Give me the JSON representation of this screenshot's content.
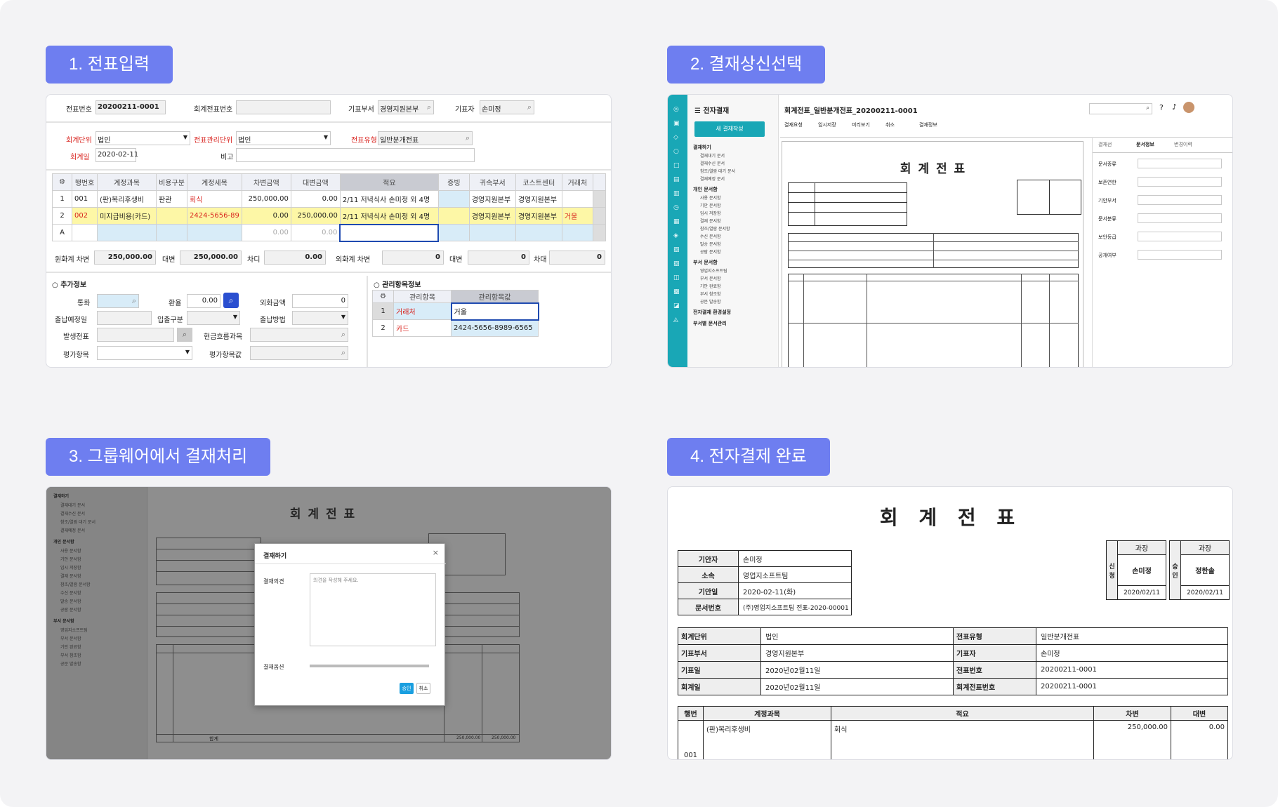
{
  "steps": [
    {
      "label": "1. 전표입력"
    },
    {
      "label": "2. 결재상신선택"
    },
    {
      "label": "3. 그룹웨어에서 결재처리"
    },
    {
      "label": "4. 전자결제 완료"
    }
  ],
  "entry": {
    "voucher_no_label": "전표번호",
    "voucher_no": "20200211-0001",
    "acct_no_label": "회계전표번호",
    "issuer_dept_label": "기표부서",
    "issuer_dept": "경영지원본부",
    "issuer_label": "기표자",
    "issuer": "손미정",
    "acct_unit_label": "회계단위",
    "acct_unit": "법인",
    "mgmt_unit_label": "전표관리단위",
    "mgmt_unit": "법인",
    "voucher_type_label": "전표유형",
    "voucher_type": "일반분개전표",
    "acct_date_label": "회계일",
    "acct_date": "2020-02-11",
    "note_label": "비고",
    "grid_headers": [
      "행번호",
      "계정과목",
      "비용구분",
      "계정세목",
      "차변금액",
      "대변금액",
      "적요",
      "증빙",
      "귀속부서",
      "코스트센터",
      "거래처"
    ],
    "rows": [
      {
        "no": "1",
        "code": "001",
        "account": "(판)복리후생비",
        "cost": "판관",
        "sub": "회식",
        "debit": "250,000.00",
        "credit": "0.00",
        "memo": "2/11 저녁식사 손미정 외 4명",
        "proof": "",
        "dept": "경영지원본부",
        "center": "경영지원본부",
        "partner": ""
      },
      {
        "no": "2",
        "code": "002",
        "account": "미지급비용(카드)",
        "cost": "",
        "sub": "2424-5656-89",
        "debit": "0.00",
        "credit": "250,000.00",
        "memo": "2/11 저녁식사 손미정 외 4명",
        "proof": "",
        "dept": "경영지원본부",
        "center": "경영지원본부",
        "partner": "거울"
      },
      {
        "no": "A",
        "code": "",
        "account": "",
        "cost": "",
        "sub": "",
        "debit": "0.00",
        "credit": "0.00",
        "memo": "",
        "proof": "",
        "dept": "",
        "center": "",
        "partner": ""
      }
    ],
    "totals": {
      "krw_debit_label": "원화계 차변",
      "krw_debit": "250,000.00",
      "krw_credit_label": "대변",
      "krw_credit": "250,000.00",
      "krw_diff_label": "차디",
      "krw_diff": "0.00",
      "fx_debit_label": "외화계 차변",
      "fx_debit": "0",
      "fx_credit_label": "대변",
      "fx_credit": "0",
      "fx_diff_label": "차대",
      "fx_diff": "0"
    },
    "extra_title": "추가정보",
    "extra": {
      "currency": "통화",
      "rate": "환율",
      "rate_value": "0.00",
      "fx_amount": "외화금액",
      "fx_amount_value": "0",
      "pay_date": "출납예정일",
      "io_type": "입출구분",
      "pay_method": "출납방법",
      "origin": "발생전표",
      "cash_flow": "현금흐름과목",
      "eval_item": "평가항목",
      "eval_value": "평가항목값"
    },
    "mgmt_title": "관리항목정보",
    "mgmt_headers": [
      "관리항목",
      "관리항목값"
    ],
    "mgmt_rows": [
      {
        "no": "1",
        "item": "거래처",
        "value": "거울"
      },
      {
        "no": "2",
        "item": "카드",
        "value": "2424-5656-8989-6565"
      }
    ]
  },
  "approval": {
    "app_title": "전자결재",
    "new_button": "새 결재작성",
    "menu_groups": [
      {
        "title": "결재하기",
        "items": [
          "결재대기 문서",
          "결재수신 문서",
          "참조/열람 대기 문서",
          "결재예정 문서"
        ]
      },
      {
        "title": "개인 문서함",
        "items": [
          "사용 문서함",
          "기안 문서함",
          "임시 저장함",
          "결재 문서함",
          "참조/열람 문서함",
          "수신 문서함",
          "발송 문서함",
          "공람 문서함"
        ]
      },
      {
        "title": "부서 문서함",
        "items": [
          "영업지소프트팀",
          "부서 문서함",
          "기안 완료함",
          "부서 참조함",
          "공문 발송함"
        ]
      },
      {
        "title": "전자결재 환경설정",
        "items": []
      },
      {
        "title": "부서별 문서관리",
        "items": []
      }
    ],
    "doc_title": "회계전표_일반분개전표_20200211-0001",
    "toolbar": [
      "결재요청",
      "임시저장",
      "미리보기",
      "취소",
      "결재정보"
    ],
    "form_heading": "회 계 전 표",
    "side_tabs": [
      "결재선",
      "문서정보",
      "변경이력"
    ],
    "side_fields": [
      "문서종류",
      "보존연한",
      "기안부서",
      "문서분류",
      "보안등급",
      "공개여부"
    ]
  },
  "groupware": {
    "form_heading": "회 계 전 표",
    "dialog_title": "결재하기",
    "opinion_label": "결재의견",
    "opinion_placeholder": "의견을 작성해 주세요.",
    "option_label": "결재옵션",
    "confirm_button": "승인",
    "cancel_button": "취소",
    "total_label": "합계",
    "total_debit": "250,000.00",
    "total_credit": "250,000.00"
  },
  "final": {
    "title": "회 계 전 표",
    "drafter_label": "기안자",
    "drafter": "손미정",
    "dept_label": "소속",
    "dept": "영업지소프트팀",
    "draft_date_label": "기안일",
    "draft_date": "2020-02-11(화)",
    "doc_no_label": "문서번호",
    "doc_no": "(주)영업지소프트팀 전표-2020-00001",
    "sign_label_1": "신청",
    "sign_label_2": "승인",
    "sign_role": "과장",
    "signer_1": "손미정",
    "sign_date_1": "2020/02/11",
    "signer_2": "정한솔",
    "sign_date_2": "2020/02/11",
    "info_rows": [
      {
        "l1": "회계단위",
        "v1": "법인",
        "l2": "전표유형",
        "v2": "일반분개전표"
      },
      {
        "l1": "기표부서",
        "v1": "경영지원본부",
        "l2": "기표자",
        "v2": "손미정"
      },
      {
        "l1": "기표일",
        "v1": "2020년02월11일",
        "l2": "전표번호",
        "v2": "20200211-0001"
      },
      {
        "l1": "회계일",
        "v1": "2020년02월11일",
        "l2": "회계전표번호",
        "v2": "20200211-0001"
      }
    ],
    "line_headers": [
      "행번",
      "계정과목",
      "적요",
      "차변",
      "대변"
    ],
    "line_account": "(판)복리후생비",
    "line_memo": "회식",
    "line_debit": "250,000.00",
    "line_credit": "0.00",
    "line_no": "001"
  }
}
